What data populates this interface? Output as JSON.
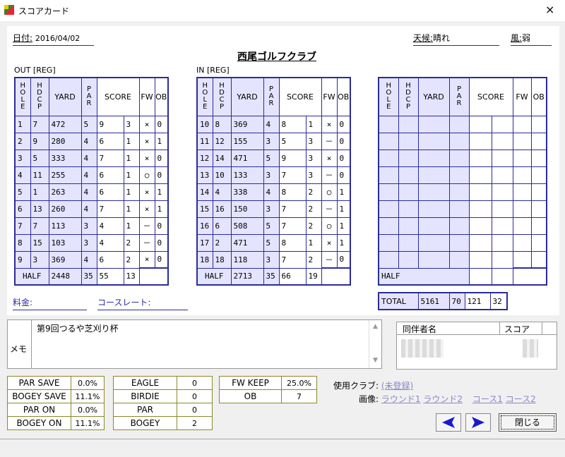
{
  "window": {
    "title": "スコアカード",
    "close": "×"
  },
  "header": {
    "date_label": "日付:",
    "date_value": "2016/04/02",
    "weather_label": "天候:",
    "weather_value": "晴れ",
    "wind_label": "風:",
    "wind_value": "弱",
    "club_name": "西尾ゴルフクラブ"
  },
  "out": {
    "label": "OUT [REG]",
    "headers": {
      "hole": "HOLE",
      "hdcp": "HDCP",
      "yard": "YARD",
      "par": "PAR",
      "score": "SCORE",
      "fw": "FW",
      "ob": "OB"
    },
    "rows": [
      [
        "1",
        "7",
        "472",
        "5",
        "9",
        "3",
        "×",
        "0"
      ],
      [
        "2",
        "9",
        "280",
        "4",
        "6",
        "1",
        "×",
        "1"
      ],
      [
        "3",
        "5",
        "333",
        "4",
        "7",
        "1",
        "×",
        "0"
      ],
      [
        "4",
        "11",
        "255",
        "4",
        "6",
        "1",
        "○",
        "0"
      ],
      [
        "5",
        "1",
        "263",
        "4",
        "6",
        "1",
        "×",
        "1"
      ],
      [
        "6",
        "13",
        "260",
        "4",
        "7",
        "1",
        "×",
        "1"
      ],
      [
        "7",
        "7",
        "113",
        "3",
        "4",
        "1",
        "－",
        "0"
      ],
      [
        "8",
        "15",
        "103",
        "3",
        "4",
        "2",
        "－",
        "0"
      ],
      [
        "9",
        "3",
        "369",
        "4",
        "6",
        "2",
        "×",
        "0"
      ]
    ],
    "half": {
      "label": "HALF",
      "yard": "2448",
      "par": "35",
      "score": "55",
      "putts": "13"
    }
  },
  "in": {
    "label": "IN [REG]",
    "headers": {
      "hole": "HOLE",
      "hdcp": "HDCP",
      "yard": "YARD",
      "par": "PAR",
      "score": "SCORE",
      "fw": "FW",
      "ob": "OB"
    },
    "rows": [
      [
        "10",
        "8",
        "369",
        "4",
        "8",
        "1",
        "×",
        "0"
      ],
      [
        "11",
        "12",
        "155",
        "3",
        "5",
        "3",
        "－",
        "0"
      ],
      [
        "12",
        "14",
        "471",
        "5",
        "9",
        "3",
        "×",
        "0"
      ],
      [
        "13",
        "10",
        "133",
        "3",
        "7",
        "3",
        "－",
        "0"
      ],
      [
        "14",
        "4",
        "338",
        "4",
        "8",
        "2",
        "○",
        "1"
      ],
      [
        "15",
        "16",
        "150",
        "3",
        "7",
        "2",
        "－",
        "1"
      ],
      [
        "16",
        "6",
        "508",
        "5",
        "7",
        "2",
        "○",
        "1"
      ],
      [
        "17",
        "2",
        "471",
        "5",
        "8",
        "1",
        "×",
        "1"
      ],
      [
        "18",
        "18",
        "118",
        "3",
        "7",
        "2",
        "－",
        "0"
      ]
    ],
    "half": {
      "label": "HALF",
      "yard": "2713",
      "par": "35",
      "score": "66",
      "putts": "19"
    }
  },
  "extra": {
    "headers": {
      "hole": "HOLE",
      "hdcp": "HDCP",
      "yard": "YARD",
      "par": "PAR",
      "score": "SCORE",
      "fw": "FW",
      "ob": "OB"
    },
    "half_label": "HALF",
    "total": {
      "label": "TOTAL",
      "yard": "5161",
      "par": "70",
      "score": "121",
      "putts": "32"
    }
  },
  "fee": {
    "fee_label": "料金:",
    "rating_label": "コースレート:"
  },
  "memo": {
    "label": "メモ",
    "text": "第9回つるや芝刈り杯"
  },
  "companions": {
    "name_header": "同伴者名",
    "score_header": "スコア"
  },
  "stats": {
    "col1": [
      [
        "PAR SAVE",
        "0.0%"
      ],
      [
        "BOGEY SAVE",
        "11.1%"
      ],
      [
        "PAR ON",
        "0.0%"
      ],
      [
        "BOGEY ON",
        "11.1%"
      ]
    ],
    "col2": [
      [
        "EAGLE",
        "0"
      ],
      [
        "BIRDIE",
        "0"
      ],
      [
        "PAR",
        "0"
      ],
      [
        "BOGEY",
        "2"
      ]
    ],
    "col3": [
      [
        "FW KEEP",
        "25.0%"
      ],
      [
        "OB",
        "7"
      ]
    ]
  },
  "links": {
    "clubs_label": "使用クラブ:",
    "clubs_value": "(未登録)",
    "images_label": "画像:",
    "round1": "ラウンド1",
    "round2": "ラウンド2",
    "course1": "コース1",
    "course2": "コース2"
  },
  "buttons": {
    "close": "閉じる"
  },
  "colors": {
    "border": "#2b2b9b",
    "header_fill": "#e4e4ff",
    "stats_border": "#8a8a2a"
  }
}
